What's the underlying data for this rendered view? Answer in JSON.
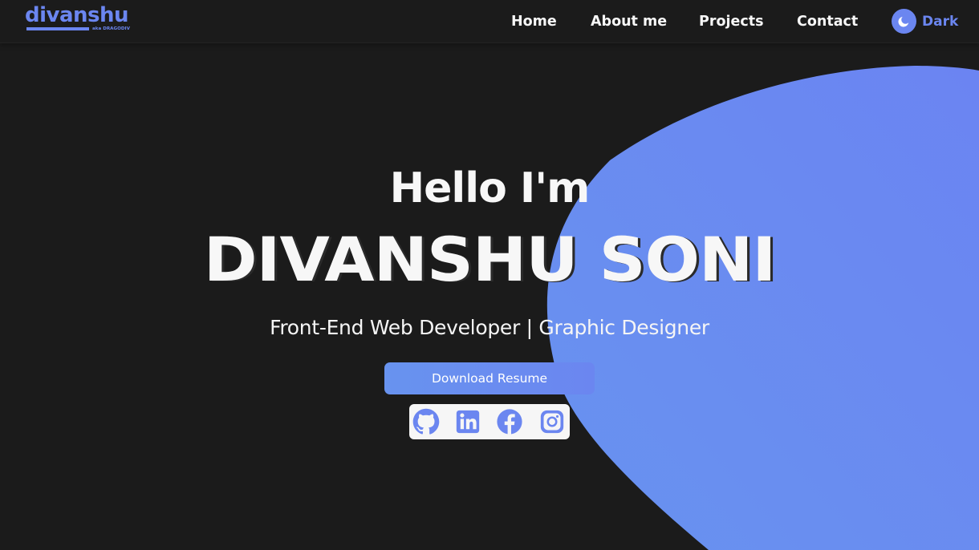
{
  "colors": {
    "background": "#1b1b1b",
    "accent": "#6b86f0",
    "blob_gradient_start": "#6893ef",
    "blob_gradient_end": "#6b84f2",
    "text": "#f7f7f7",
    "social_bg": "#f6f6f6"
  },
  "navbar": {
    "logo": {
      "text": "divanshu",
      "subtext": "aka DRAGODIV"
    },
    "links": [
      {
        "label": "Home"
      },
      {
        "label": "About me"
      },
      {
        "label": "Projects"
      },
      {
        "label": "Contact"
      }
    ],
    "theme_toggle": {
      "icon": "moon-icon",
      "label": "Dark"
    }
  },
  "hero": {
    "greeting": "Hello I'm",
    "name": "DIVANSHU SONI",
    "tagline": {
      "role1": "Front-End Web Developer",
      "separator": "|",
      "role2": "Graphic Designer"
    },
    "resume_button": "Download Resume",
    "socials": [
      {
        "icon": "github-icon"
      },
      {
        "icon": "linkedin-icon"
      },
      {
        "icon": "facebook-icon"
      },
      {
        "icon": "instagram-icon"
      }
    ]
  }
}
